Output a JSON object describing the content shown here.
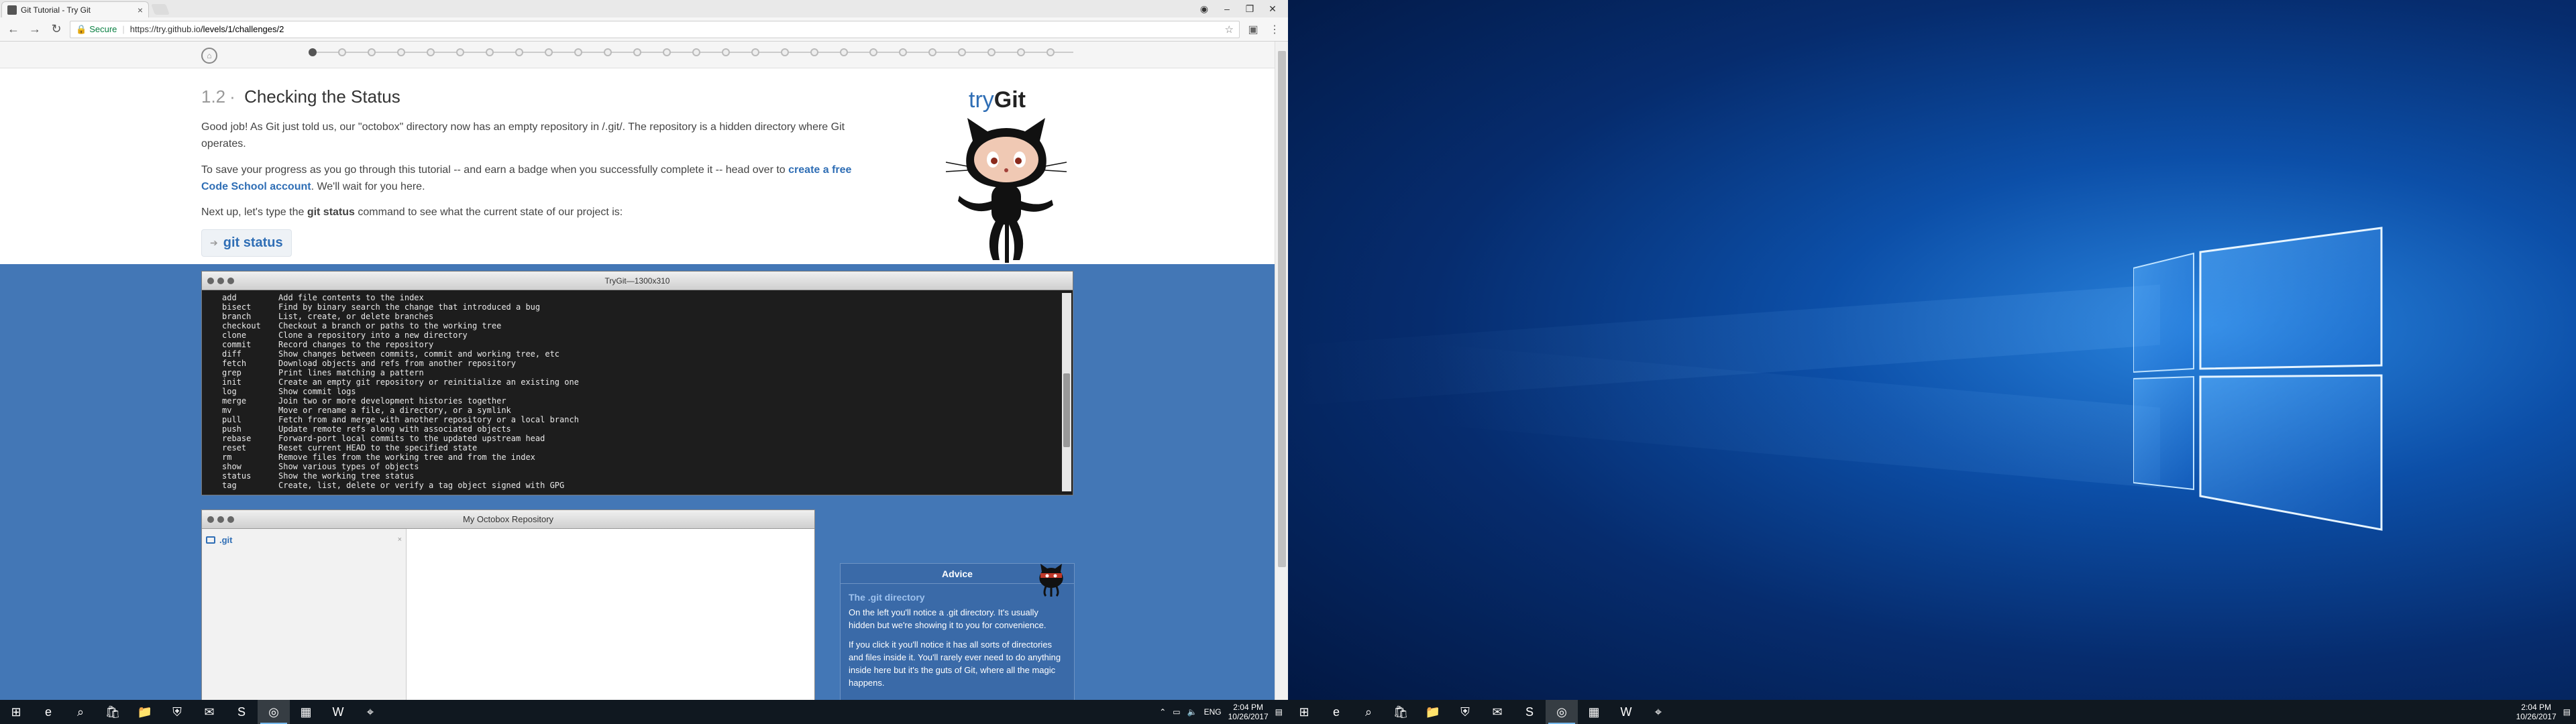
{
  "browser": {
    "tab_title": "Git Tutorial - Try Git",
    "secure_label": "Secure",
    "url_host": "https://try.github.io",
    "url_path": "/levels/1/challenges/2"
  },
  "lesson": {
    "number": "1.2",
    "separator": "·",
    "title": "Checking the Status",
    "p1": "Good job! As Git just told us, our \"octobox\" directory now has an empty repository in /.git/. The repository is a hidden directory where Git operates.",
    "p2_before": "To save your progress as you go through this tutorial -- and earn a badge when you successfully complete it -- head over to ",
    "p2_link": "create a free Code School account",
    "p2_after": ". We'll wait for you here.",
    "p3_before": "Next up, let's type the ",
    "p3_cmd": "git status",
    "p3_after": " command to see what the current state of our project is:",
    "command": "git status"
  },
  "logo": {
    "try": "try",
    "git": "Git"
  },
  "terminal": {
    "title": "TryGit—1300x310",
    "rows": [
      [
        "add",
        "Add file contents to the index"
      ],
      [
        "bisect",
        "Find by binary search the change that introduced a bug"
      ],
      [
        "branch",
        "List, create, or delete branches"
      ],
      [
        "checkout",
        "Checkout a branch or paths to the working tree"
      ],
      [
        "clone",
        "Clone a repository into a new directory"
      ],
      [
        "commit",
        "Record changes to the repository"
      ],
      [
        "diff",
        "Show changes between commits, commit and working tree, etc"
      ],
      [
        "fetch",
        "Download objects and refs from another repository"
      ],
      [
        "grep",
        "Print lines matching a pattern"
      ],
      [
        "init",
        "Create an empty git repository or reinitialize an existing one"
      ],
      [
        "log",
        "Show commit logs"
      ],
      [
        "merge",
        "Join two or more development histories together"
      ],
      [
        "mv",
        "Move or rename a file, a directory, or a symlink"
      ],
      [
        "pull",
        "Fetch from and merge with another repository or a local branch"
      ],
      [
        "push",
        "Update remote refs along with associated objects"
      ],
      [
        "rebase",
        "Forward-port local commits to the updated upstream head"
      ],
      [
        "reset",
        "Reset current HEAD to the specified state"
      ],
      [
        "rm",
        "Remove files from the working tree and from the index"
      ],
      [
        "show",
        "Show various types of objects"
      ],
      [
        "status",
        "Show the working tree status"
      ],
      [
        "tag",
        "Create, list, delete or verify a tag object signed with GPG"
      ]
    ]
  },
  "repo": {
    "title": "My Octobox Repository",
    "item": ".git",
    "close": "×"
  },
  "advice": {
    "title": "Advice",
    "subtitle": "The .git directory",
    "p1": "On the left you'll notice a .git directory. It's usually hidden but we're showing it to you for convenience.",
    "p2": "If you click it you'll notice it has all sorts of directories and files inside it. You'll rarely ever need to do anything inside here but it's the guts of Git, where all the magic happens."
  },
  "taskbar": {
    "lang": "ENG",
    "time": "2:04 PM",
    "date": "10/26/2017",
    "icons": [
      "start-icon",
      "edge-icon",
      "search-icon",
      "store-icon",
      "file-explorer-icon",
      "security-icon",
      "mail-icon",
      "skype-icon",
      "chrome-icon",
      "photos-icon",
      "word-icon",
      "maps-icon"
    ]
  }
}
